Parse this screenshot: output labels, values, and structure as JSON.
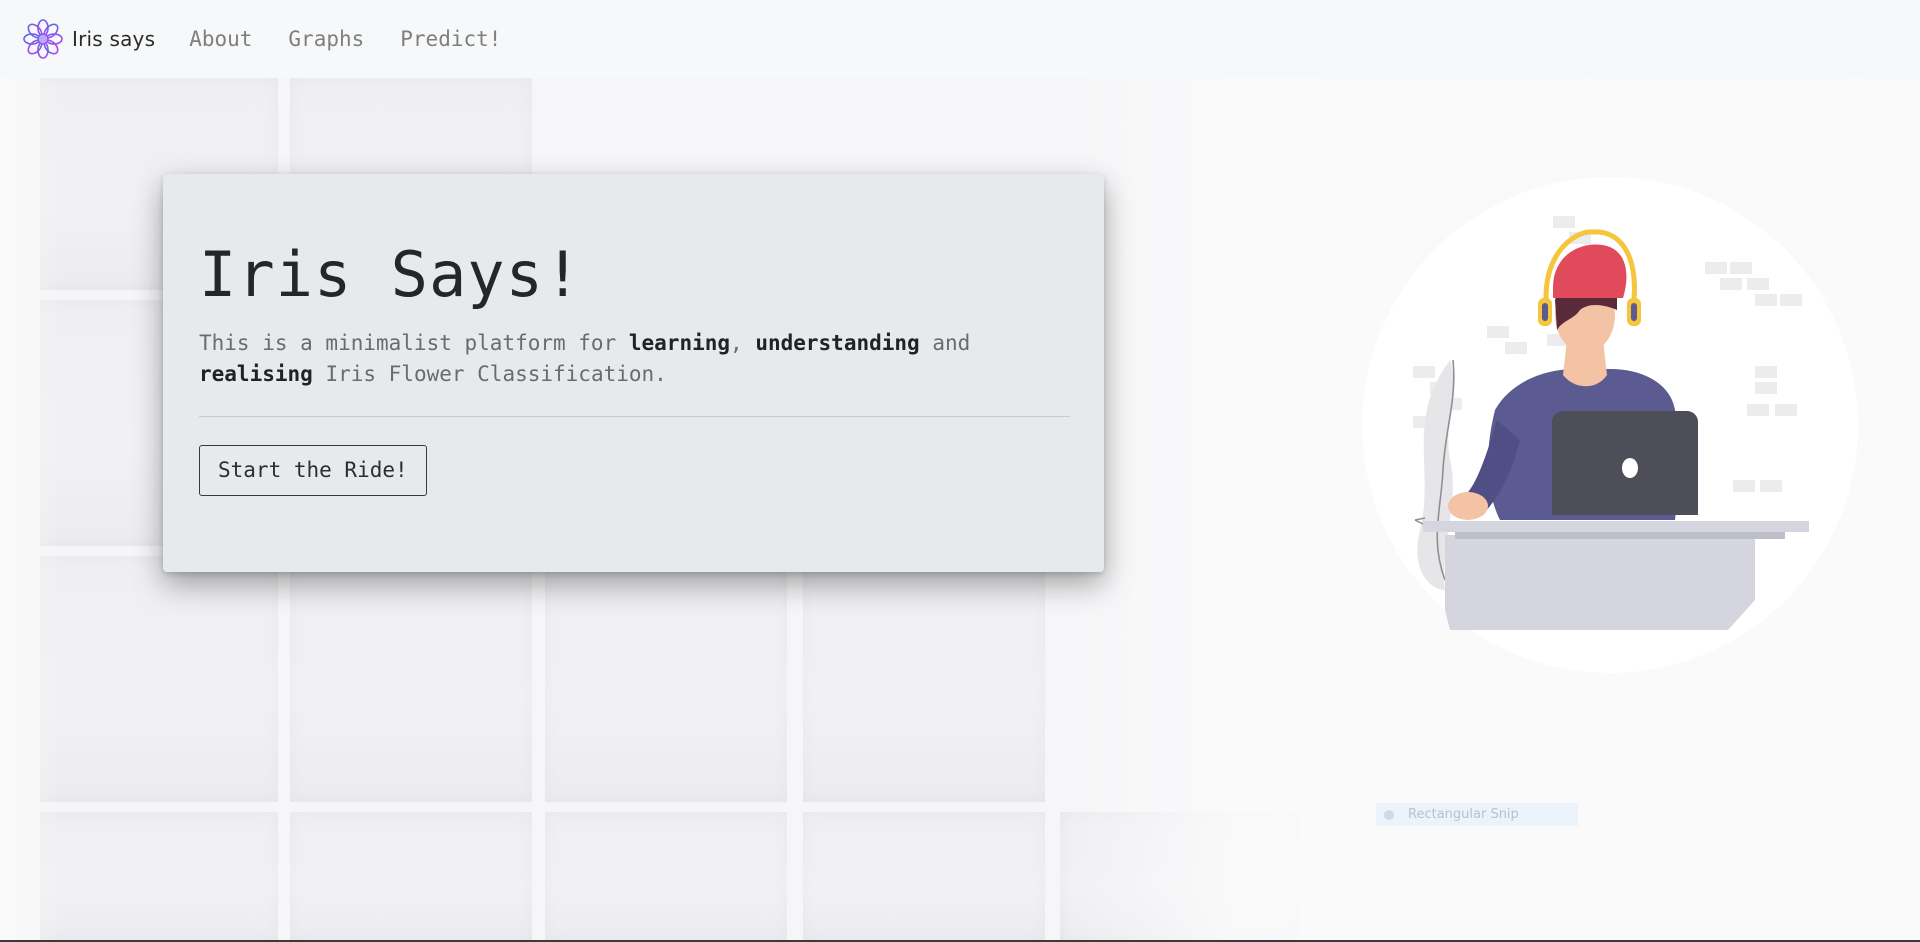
{
  "navbar": {
    "brand": "Iris says",
    "links": [
      "About",
      "Graphs",
      "Predict!"
    ]
  },
  "hero": {
    "title": "Iris Says!",
    "lead_prefix": "This is a minimalist platform for ",
    "lead_word1": "learning",
    "lead_sep1": ", ",
    "lead_word2": "understanding",
    "lead_sep2": " and ",
    "lead_word3": "realising",
    "lead_suffix": " Iris Flower Classification.",
    "cta_label": "Start the Ride!"
  },
  "overlay": {
    "snip_label": "Rectangular Snip"
  },
  "colors": {
    "card_bg": "#e7eaed",
    "navbar_bg": "#f7f8f9",
    "logo_purple": "#a050e8",
    "logo_blue": "#5a6cf0",
    "shirt": "#5b5b92",
    "cap": "#e04a5a",
    "headphones": "#f5c53c",
    "laptop": "#4e4e58",
    "desk": "#d5d5df"
  },
  "icons": {
    "brand_logo": "flower-logo-icon",
    "snip": "snip-icon"
  }
}
